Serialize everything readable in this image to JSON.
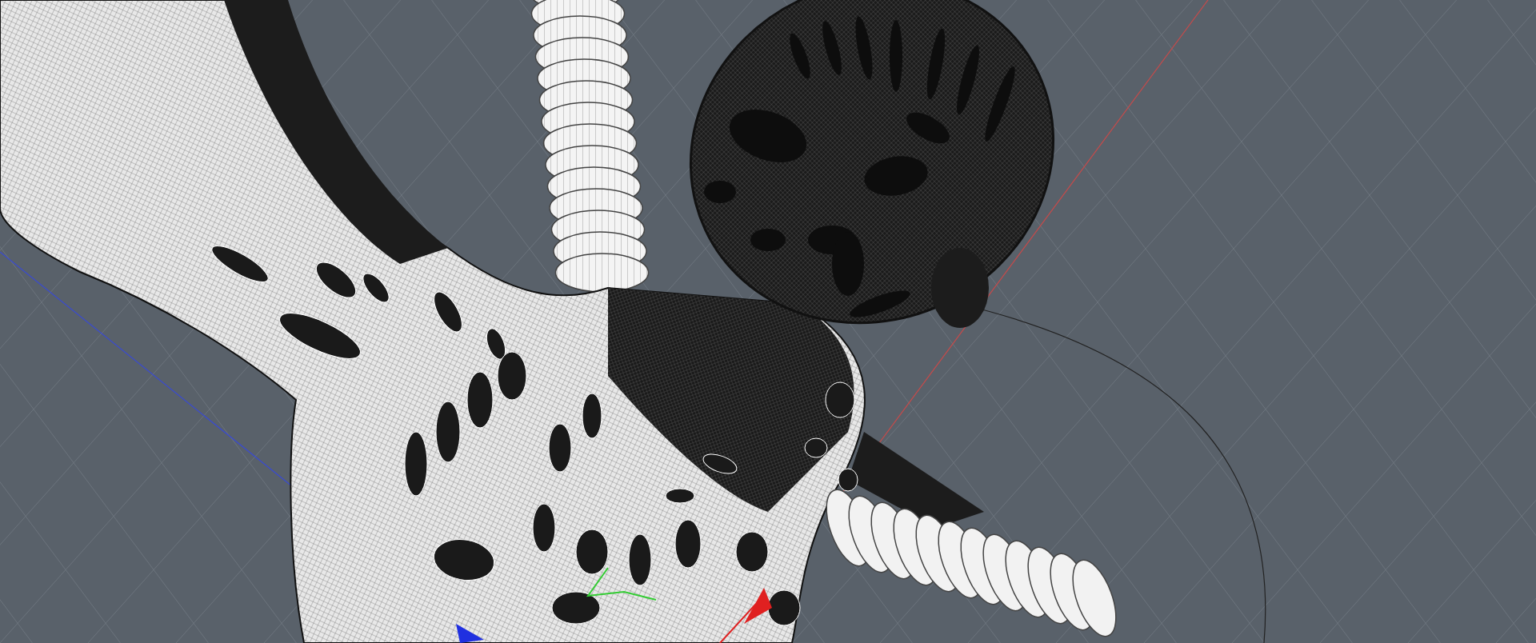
{
  "viewport": {
    "grid": true,
    "gizmo": true
  }
}
